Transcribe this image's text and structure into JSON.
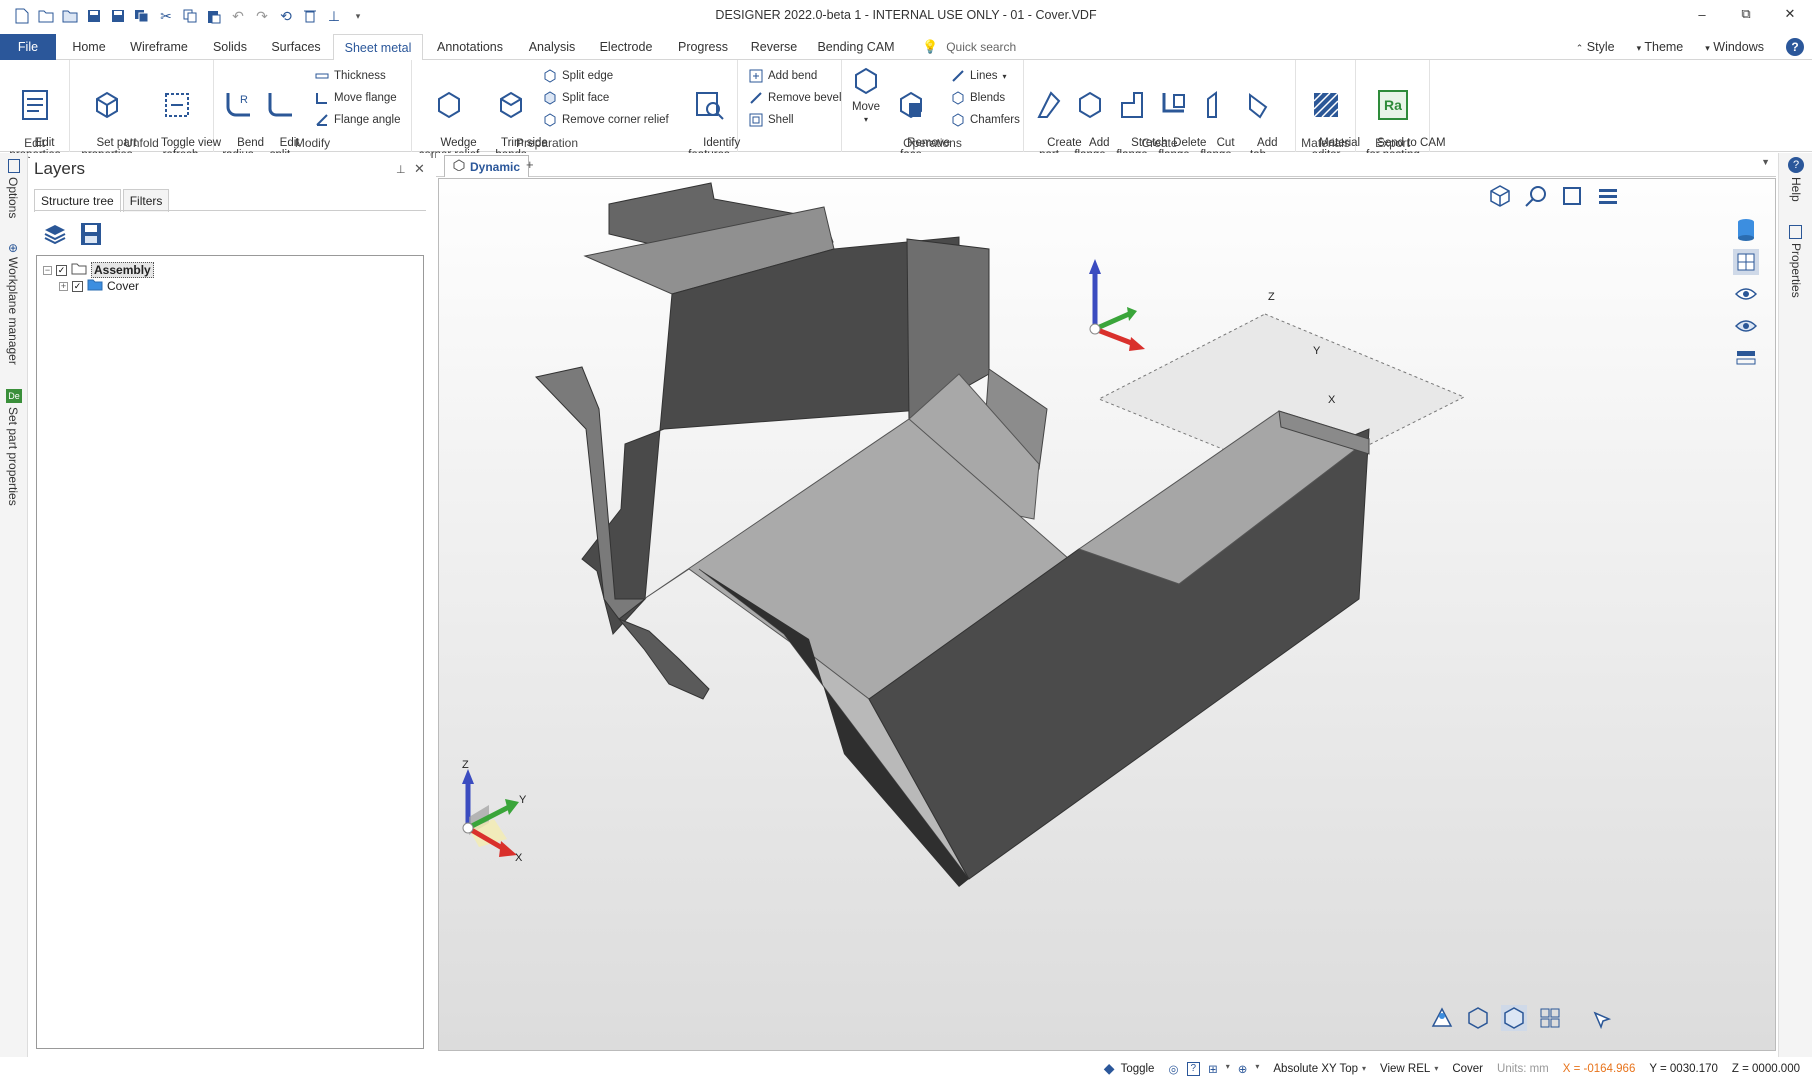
{
  "window": {
    "title": "DESIGNER 2022.0-beta 1 - INTERNAL USE ONLY - 01 - Cover.VDF",
    "minimize": "–",
    "restore": "⧉",
    "close": "✕"
  },
  "tabs": [
    {
      "label": "File"
    },
    {
      "label": "Home"
    },
    {
      "label": "Wireframe"
    },
    {
      "label": "Solids"
    },
    {
      "label": "Surfaces"
    },
    {
      "label": "Sheet metal"
    },
    {
      "label": "Annotations"
    },
    {
      "label": "Analysis"
    },
    {
      "label": "Electrode"
    },
    {
      "label": "Progress"
    },
    {
      "label": "Reverse"
    },
    {
      "label": "Bending CAM"
    }
  ],
  "search": {
    "placeholder": "Quick search"
  },
  "rightmenu": {
    "style": "Style",
    "theme": "Theme",
    "windows": "Windows",
    "help": "?"
  },
  "ribbon": {
    "edit": {
      "label": "Edit",
      "edit_properties": "Edit\nproperties"
    },
    "unfold": {
      "label": "Unfold",
      "set_part_properties": "Set part\nproperties",
      "toggle_view": "Toggle view\n- refresh"
    },
    "modify": {
      "label": "Modify",
      "bend_radius": "Bend\nradius",
      "edit_split": "Edit\nsplit",
      "thickness": "Thickness",
      "move_flange": "Move flange",
      "flange_angle": "Flange angle"
    },
    "preparation": {
      "label": "Preparation",
      "wedge": "Wedge\ncorner relief",
      "trim": "Trim side\nbends",
      "split_edge": "Split edge",
      "split_face": "Split face",
      "remove_corner_relief": "Remove corner relief",
      "identify": "Identify\nfeatures",
      "add_bend": "Add bend",
      "remove_bevel": "Remove bevel",
      "shell": "Shell"
    },
    "operations": {
      "label": "Operations",
      "move": "Move",
      "remove_face": "Remove\nface",
      "lines": "Lines",
      "blends": "Blends",
      "chamfers": "Chamfers"
    },
    "create": {
      "label": "Create",
      "create_part": "Create\npart",
      "add_flange": "Add\nflange",
      "stretch_flange": "Stretch\nflange",
      "delete_flange": "Delete\nflange",
      "cut_flange": "Cut\nflange",
      "add_tab": "Add\ntab"
    },
    "materials": {
      "label": "Materials",
      "material_editor": "Material\neditor"
    },
    "export": {
      "label": "Export",
      "send_to_cam": "Send to CAM\nfor nesting",
      "ra": "Ra"
    }
  },
  "leftstrip": {
    "options": "Options",
    "workplane": "Workplane manager",
    "setpart": "Set part properties",
    "de": "De"
  },
  "layers": {
    "title": "Layers",
    "tab_structure": "Structure tree",
    "tab_filters": "Filters",
    "tree": [
      {
        "label": "Assembly"
      },
      {
        "label": "Cover"
      }
    ]
  },
  "viewport": {
    "tab": "Dynamic",
    "add": "+"
  },
  "rightstrip": {
    "help": "Help",
    "properties": "Properties"
  },
  "axes": {
    "x": "X",
    "y": "Y",
    "z": "Z"
  },
  "status": {
    "toggle": "Toggle",
    "absolute": "Absolute XY Top",
    "view": "View REL",
    "part": "Cover",
    "units": "Units: mm",
    "x": "X = -0164.966",
    "y": "Y = 0030.170",
    "z": "Z = 0000.000"
  },
  "colors": {
    "accent": "#2b579a",
    "status_x": "#e8741c",
    "axis_x": "#d9302c",
    "axis_y": "#3aa53a",
    "axis_z": "#3b4cc0"
  }
}
